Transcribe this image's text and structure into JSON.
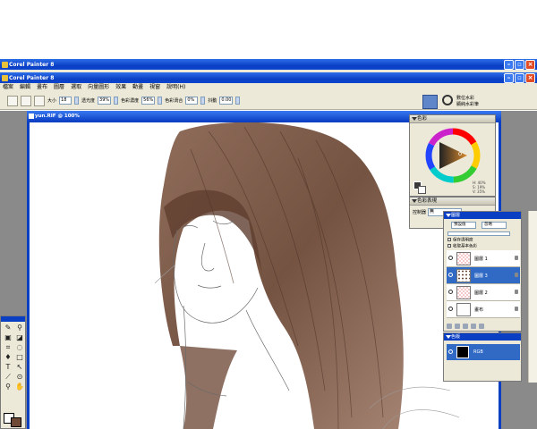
{
  "app": {
    "window_title_back": "Corel Painter 8",
    "window_title_front": "Corel Painter 8"
  },
  "menu": [
    "檔案",
    "編輯",
    "畫布",
    "圖層",
    "選取",
    "向量圖形",
    "效果",
    "動畫",
    "視窗",
    "說明(H)"
  ],
  "properties": {
    "size_label": "大小",
    "size_value": "18",
    "opacity_label": "透光度",
    "opacity_value": "39%",
    "grain_label": "色彩濃度",
    "grain_value": "56%",
    "resat_label": "色彩渦合",
    "resat_value": "0%",
    "jitter_label": "抖動",
    "jitter_value": "0.00"
  },
  "brush": {
    "category": "數位水彩",
    "variant": "顯純水彩筆"
  },
  "document": {
    "title": "yun.RIF @ 100%"
  },
  "color_panel": {
    "title": "色彩",
    "h_value": "H: 40%",
    "s_value": "S: 19%",
    "v_value": "V: 35%",
    "colors": {
      "hue_ring": "#e8a040",
      "selected": "#8a5a34"
    }
  },
  "mixer_panel": {
    "title": "色彩表現",
    "control_label": "控制器",
    "control_value": "無"
  },
  "layers_panel": {
    "title": "圖層",
    "composite_method": "預設值",
    "depth": "忽略",
    "preserve_transparency": "保存透明度",
    "pick_up_color": "收取基本色彩",
    "layers": [
      {
        "name": "圖層 1",
        "selected": false
      },
      {
        "name": "圖層 3",
        "selected": true
      },
      {
        "name": "圖層 2",
        "selected": false
      },
      {
        "name": "畫布",
        "selected": false
      }
    ]
  },
  "channels_panel": {
    "title": "色版",
    "channel_name": "RGB"
  }
}
